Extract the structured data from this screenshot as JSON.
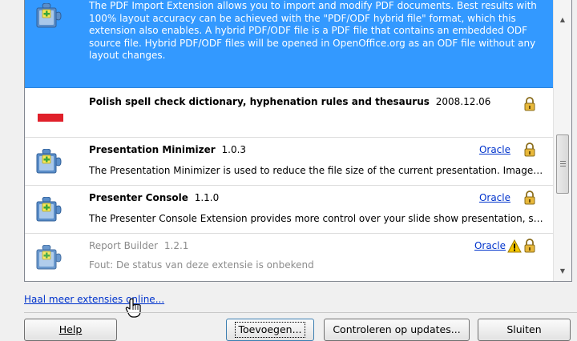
{
  "extensions": [
    {
      "description": "The PDF Import Extension allows you to import and modify PDF documents. Best results with 100% layout accuracy can be achieved with the \"PDF/ODF hybrid file\" format, which this extension also enables. A hybrid PDF/ODF file is a PDF file that contains an embedded ODF source file. Hybrid PDF/ODF files will be opened in OpenOffice.org as an ODF file without any layout changes.",
      "icon": "puzzle-icon",
      "selected": true
    },
    {
      "name": "Polish spell check dictionary, hyphenation rules and thesaurus",
      "version": "2008.12.06",
      "icon": "polish-flag-icon"
    },
    {
      "name": "Presentation Minimizer",
      "version": "1.0.3",
      "publisher": "Oracle",
      "description": "The Presentation Minimizer is used to reduce the file size of the current presentation. Images wi...",
      "icon": "puzzle-icon"
    },
    {
      "name": "Presenter Console",
      "version": "1.1.0",
      "publisher": "Oracle",
      "description": "The Presenter Console Extension provides more control over your slide show presentation, such...",
      "icon": "puzzle-icon"
    },
    {
      "name": "Report Builder",
      "version": "1.2.1",
      "publisher": "Oracle",
      "description": "Fout: De status van deze extensie is onbekend",
      "icon": "puzzle-icon",
      "warning": true
    }
  ],
  "footer": {
    "more_link": "Haal meer extensies online...",
    "buttons": {
      "help": "Help",
      "add": "Toevoegen...",
      "check_updates": "Controleren op updates...",
      "close": "Sluiten"
    }
  },
  "colors": {
    "selection": "#3399ff",
    "link": "#0033cc",
    "disabled_text": "#8c8c8c"
  }
}
